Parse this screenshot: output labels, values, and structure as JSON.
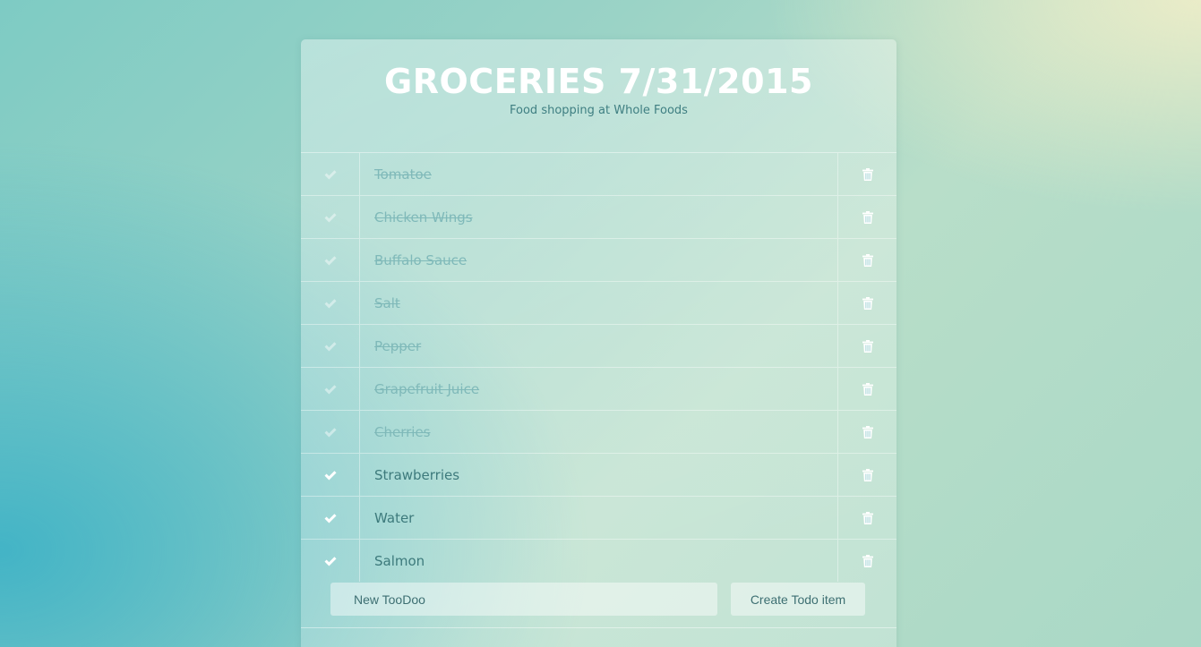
{
  "header": {
    "title": "GROCERIES 7/31/2015",
    "subtitle": "Food shopping at Whole Foods"
  },
  "todos": [
    {
      "label": "Tomatoe",
      "completed": true
    },
    {
      "label": "Chicken Wings",
      "completed": true
    },
    {
      "label": "Buffalo Sauce",
      "completed": true
    },
    {
      "label": "Salt",
      "completed": true
    },
    {
      "label": "Pepper",
      "completed": true
    },
    {
      "label": "Grapefruit Juice",
      "completed": true
    },
    {
      "label": "Cherries",
      "completed": true
    },
    {
      "label": "Strawberries",
      "completed": false
    },
    {
      "label": "Water",
      "completed": false
    },
    {
      "label": "Salmon",
      "completed": false
    }
  ],
  "new_item": {
    "placeholder": "New TooDoo",
    "button_label": "Create Todo item"
  },
  "icons": {
    "check": "checkmark-icon",
    "delete": "trash-icon"
  },
  "colors": {
    "completed_text": "#7fb9b9",
    "open_text": "#3d7a7c",
    "title": "#ffffff"
  }
}
